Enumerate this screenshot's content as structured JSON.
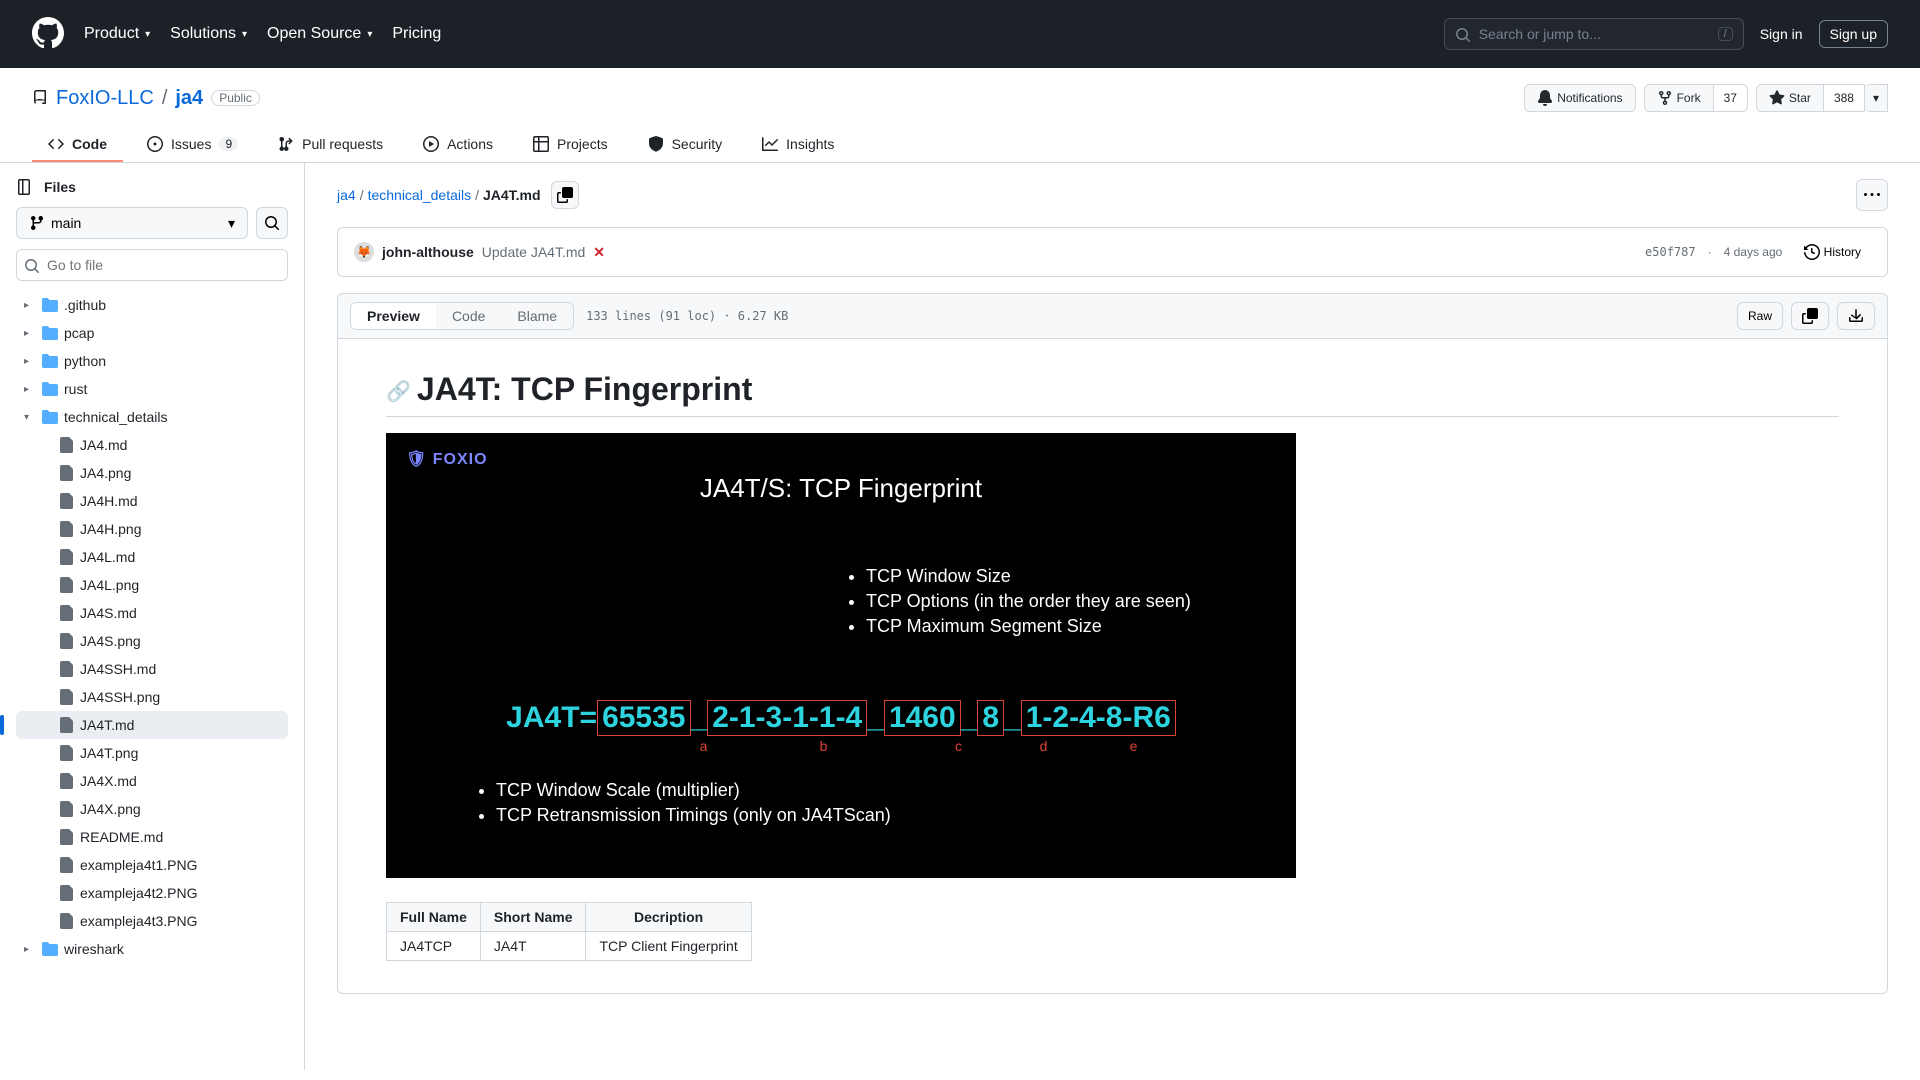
{
  "nav": {
    "product": "Product",
    "solutions": "Solutions",
    "opensource": "Open Source",
    "pricing": "Pricing",
    "search_placeholder": "Search or jump to...",
    "slash": "/",
    "signin": "Sign in",
    "signup": "Sign up"
  },
  "repo": {
    "owner": "FoxIO-LLC",
    "name": "ja4",
    "visibility": "Public",
    "notifications": "Notifications",
    "fork": "Fork",
    "fork_count": "37",
    "star": "Star",
    "star_count": "388"
  },
  "tabs": {
    "code": "Code",
    "issues": "Issues",
    "issues_count": "9",
    "pulls": "Pull requests",
    "actions": "Actions",
    "projects": "Projects",
    "security": "Security",
    "insights": "Insights"
  },
  "sidebar": {
    "files": "Files",
    "branch": "main",
    "filter_placeholder": "Go to file",
    "tree": {
      "github": ".github",
      "pcap": "pcap",
      "python": "python",
      "rust": "rust",
      "tech": "technical_details",
      "files": [
        "JA4.md",
        "JA4.png",
        "JA4H.md",
        "JA4H.png",
        "JA4L.md",
        "JA4L.png",
        "JA4S.md",
        "JA4S.png",
        "JA4SSH.md",
        "JA4SSH.png",
        "JA4T.md",
        "JA4T.png",
        "JA4X.md",
        "JA4X.png",
        "README.md",
        "exampleja4t1.PNG",
        "exampleja4t2.PNG",
        "exampleja4t3.PNG"
      ],
      "wireshark": "wireshark"
    }
  },
  "crumbs": {
    "root": "ja4",
    "dir": "technical_details",
    "file": "JA4T.md"
  },
  "commit": {
    "author": "john-althouse",
    "message": "Update JA4T.md",
    "hash": "e50f787",
    "date": "4 days ago",
    "history": "History"
  },
  "filebar": {
    "preview": "Preview",
    "code": "Code",
    "blame": "Blame",
    "info": "133 lines (91 loc) · 6.27 KB",
    "raw": "Raw"
  },
  "readme": {
    "h1": "JA4T: TCP Fingerprint"
  },
  "diagram": {
    "logo": "🛡 FOXIO",
    "title": "JA4T/S: TCP Fingerprint",
    "top_bullets": [
      "TCP Window Size",
      "TCP Options (in the order they are seen)",
      "TCP Maximum Segment Size"
    ],
    "prefix": "JA4T=",
    "seg_a": "65535",
    "seg_b": "2-1-3-1-1-4",
    "seg_c": "1460",
    "seg_d": "8",
    "seg_e": "1-2-4-8-R6",
    "us": "_",
    "letters": {
      "a": "a",
      "b": "b",
      "c": "c",
      "d": "d",
      "e": "e"
    },
    "bot_bullets": [
      "TCP Window Scale (multiplier)",
      "TCP Retransmission Timings (only on JA4TScan)"
    ]
  },
  "table": {
    "h1": "Full Name",
    "h2": "Short Name",
    "h3": "Decription",
    "r1c1": "JA4TCP",
    "r1c2": "JA4T",
    "r1c3": "TCP Client Fingerprint"
  }
}
